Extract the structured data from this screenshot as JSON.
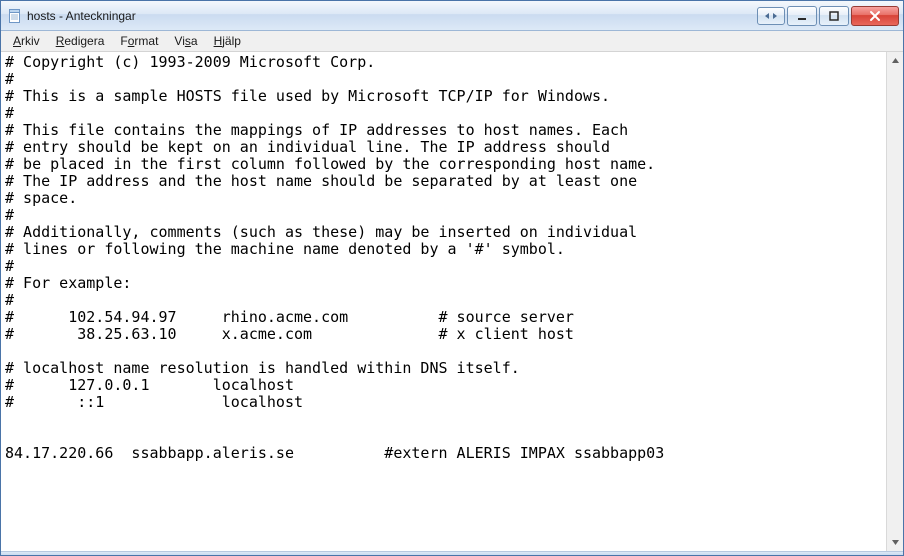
{
  "window": {
    "title": "hosts - Anteckningar"
  },
  "menu": {
    "arkiv_accel": "A",
    "arkiv_rest": "rkiv",
    "redigera_accel": "R",
    "redigera_rest": "edigera",
    "format_pre": "F",
    "format_accel": "o",
    "format_rest": "rmat",
    "visa_pre": "Vi",
    "visa_accel": "s",
    "visa_rest": "a",
    "hjalp_accel": "H",
    "hjalp_rest": "jälp"
  },
  "editor": {
    "text": "# Copyright (c) 1993-2009 Microsoft Corp.\n#\n# This is a sample HOSTS file used by Microsoft TCP/IP for Windows.\n#\n# This file contains the mappings of IP addresses to host names. Each\n# entry should be kept on an individual line. The IP address should\n# be placed in the first column followed by the corresponding host name.\n# The IP address and the host name should be separated by at least one\n# space.\n#\n# Additionally, comments (such as these) may be inserted on individual\n# lines or following the machine name denoted by a '#' symbol.\n#\n# For example:\n#\n#      102.54.94.97     rhino.acme.com          # source server\n#       38.25.63.10     x.acme.com              # x client host\n\n# localhost name resolution is handled within DNS itself.\n#      127.0.0.1       localhost\n#       ::1             localhost\n\n\n84.17.220.66  ssabbapp.aleris.se          #extern ALERIS IMPAX ssabbapp03"
  }
}
